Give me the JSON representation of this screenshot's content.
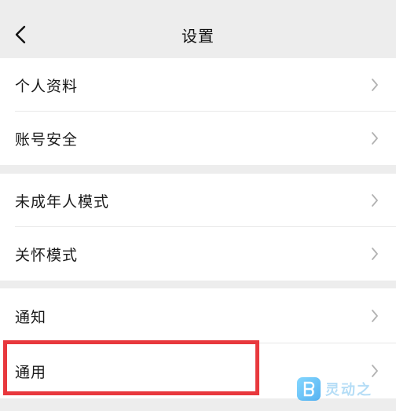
{
  "header": {
    "title": "设置",
    "back_icon": "chevron-left-icon"
  },
  "groups": [
    {
      "items": [
        {
          "label": "个人资料"
        },
        {
          "label": "账号安全"
        }
      ]
    },
    {
      "items": [
        {
          "label": "未成年人模式"
        },
        {
          "label": "关怀模式"
        }
      ]
    },
    {
      "items": [
        {
          "label": "通知"
        },
        {
          "label": "通用"
        }
      ]
    }
  ],
  "colors": {
    "highlight": "#e8383d",
    "background": "#ededed",
    "row_bg": "#ffffff"
  },
  "watermark": {
    "text": "灵动之"
  }
}
